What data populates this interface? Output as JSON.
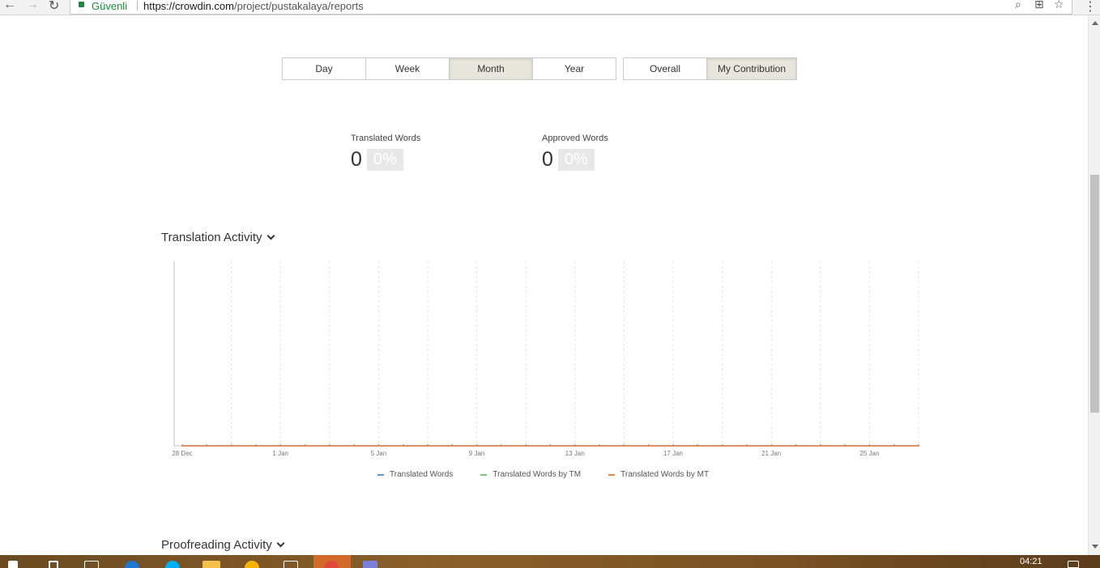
{
  "browser": {
    "secure_label": "Güvenli",
    "url_host": "https://crowdin.com",
    "url_path": "/project/pustakalaya/reports"
  },
  "period_tabs": [
    "Day",
    "Week",
    "Month",
    "Year"
  ],
  "period_active": "Month",
  "scope_tabs": [
    "Overall",
    "My Contribution"
  ],
  "scope_active": "My Contribution",
  "stats": {
    "translated": {
      "label": "Translated Words",
      "value": "0",
      "pct": "0%"
    },
    "approved": {
      "label": "Approved Words",
      "value": "0",
      "pct": "0%"
    }
  },
  "sections": {
    "translation_activity": "Translation Activity",
    "proofreading_activity": "Proofreading Activity"
  },
  "chart_data": {
    "type": "line",
    "x": [
      "28 Dec",
      "29 Dec",
      "30 Dec",
      "31 Dec",
      "1 Jan",
      "2 Jan",
      "3 Jan",
      "4 Jan",
      "5 Jan",
      "6 Jan",
      "7 Jan",
      "8 Jan",
      "9 Jan",
      "10 Jan",
      "11 Jan",
      "12 Jan",
      "13 Jan",
      "14 Jan",
      "15 Jan",
      "16 Jan",
      "17 Jan",
      "18 Jan",
      "19 Jan",
      "20 Jan",
      "21 Jan",
      "22 Jan",
      "23 Jan",
      "24 Jan",
      "25 Jan",
      "26 Jan",
      "27 Jan"
    ],
    "x_tick_labels": [
      "28 Dec",
      "1 Jan",
      "5 Jan",
      "9 Jan",
      "13 Jan",
      "17 Jan",
      "21 Jan",
      "25 Jan"
    ],
    "series": [
      {
        "name": "Translated Words",
        "color": "#5b9bd5",
        "values": [
          0,
          0,
          0,
          0,
          0,
          0,
          0,
          0,
          0,
          0,
          0,
          0,
          0,
          0,
          0,
          0,
          0,
          0,
          0,
          0,
          0,
          0,
          0,
          0,
          0,
          0,
          0,
          0,
          0,
          0,
          0
        ]
      },
      {
        "name": "Translated Words by TM",
        "color": "#7cc47c",
        "values": [
          0,
          0,
          0,
          0,
          0,
          0,
          0,
          0,
          0,
          0,
          0,
          0,
          0,
          0,
          0,
          0,
          0,
          0,
          0,
          0,
          0,
          0,
          0,
          0,
          0,
          0,
          0,
          0,
          0,
          0,
          0
        ]
      },
      {
        "name": "Translated Words by MT",
        "color": "#f08050",
        "values": [
          0,
          0,
          0,
          0,
          0,
          0,
          0,
          0,
          0,
          0,
          0,
          0,
          0,
          0,
          0,
          0,
          0,
          0,
          0,
          0,
          0,
          0,
          0,
          0,
          0,
          0,
          0,
          0,
          0,
          0,
          0
        ]
      }
    ],
    "grid": true,
    "legend": "bottom-center"
  },
  "taskbar": {
    "clock": "04:21"
  }
}
